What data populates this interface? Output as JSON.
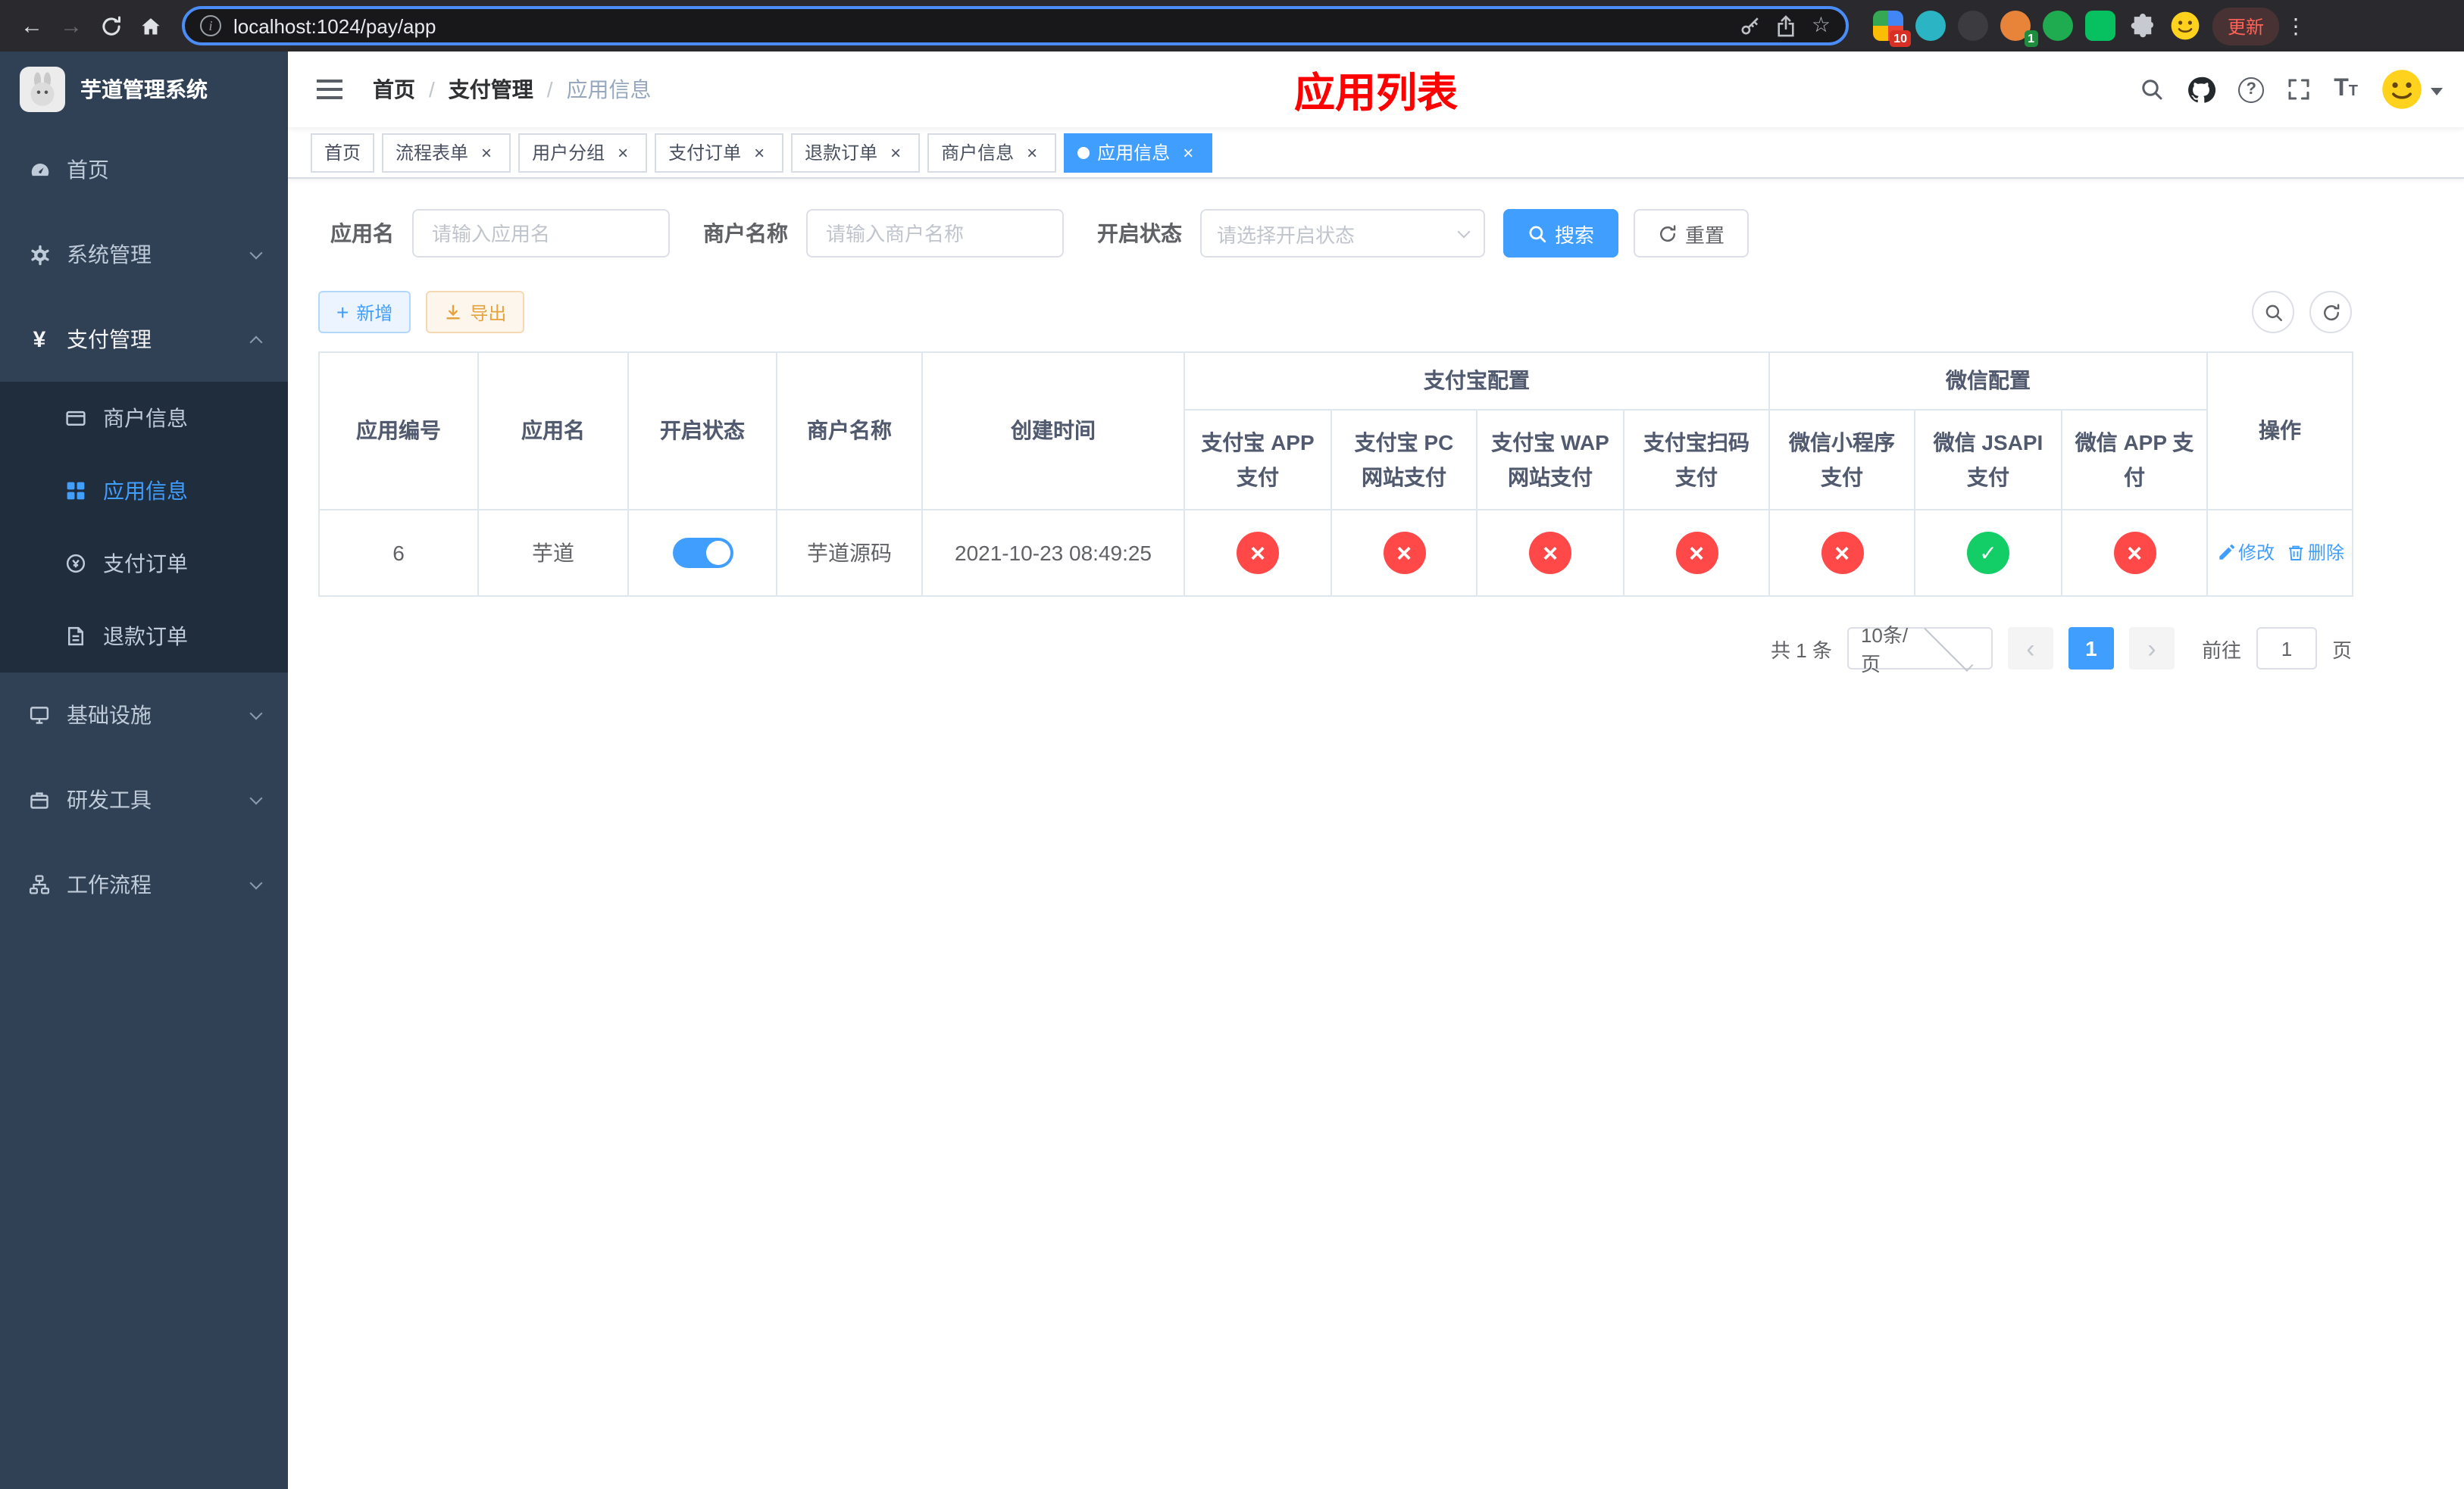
{
  "theme": {
    "accent": "#409eff",
    "danger_red": "#ff4949",
    "success_green": "#13ce66",
    "title_red": "#ff0000",
    "sidebar_bg": "#304156",
    "submenu_bg": "#1f2d3d"
  },
  "browser": {
    "url": "localhost:1024/pay/app",
    "update_label": "更新",
    "ext_badge1": "10",
    "ext_badge2": "1"
  },
  "sidebar": {
    "title": "芋道管理系统",
    "items": [
      {
        "label": "首页"
      },
      {
        "label": "系统管理"
      },
      {
        "label": "支付管理"
      },
      {
        "label": "基础设施"
      },
      {
        "label": "研发工具"
      },
      {
        "label": "工作流程"
      }
    ],
    "submenu": [
      {
        "label": "商户信息"
      },
      {
        "label": "应用信息"
      },
      {
        "label": "支付订单"
      },
      {
        "label": "退款订单"
      }
    ]
  },
  "navbar": {
    "breadcrumb": {
      "home": "首页",
      "section": "支付管理",
      "current": "应用信息",
      "separator": "/"
    },
    "page_title": "应用列表"
  },
  "tabs": [
    {
      "label": "首页"
    },
    {
      "label": "流程表单"
    },
    {
      "label": "用户分组"
    },
    {
      "label": "支付订单"
    },
    {
      "label": "退款订单"
    },
    {
      "label": "商户信息"
    },
    {
      "label": "应用信息"
    }
  ],
  "filters": {
    "app_name": {
      "label": "应用名",
      "placeholder": "请输入应用名"
    },
    "merchant_name": {
      "label": "商户名称",
      "placeholder": "请输入商户名称"
    },
    "status": {
      "label": "开启状态",
      "placeholder": "请选择开启状态"
    },
    "search_label": "搜索",
    "reset_label": "重置"
  },
  "toolbar": {
    "add_label": "新增",
    "export_label": "导出"
  },
  "table": {
    "headers": {
      "app_id": "应用编号",
      "app_name": "应用名",
      "status": "开启状态",
      "merchant": "商户名称",
      "created": "创建时间",
      "alipay_group": "支付宝配置",
      "wechat_group": "微信配置",
      "alipay_app": "支付宝 APP 支付",
      "alipay_pc": "支付宝 PC 网站支付",
      "alipay_wap": "支付宝 WAP 网站支付",
      "alipay_qr": "支付宝扫码支付",
      "wechat_lite": "微信小程序支付",
      "wechat_jsapi": "微信 JSAPI 支付",
      "wechat_app": "微信 APP 支付",
      "actions": "操作"
    },
    "row": {
      "app_id": "6",
      "app_name": "芋道",
      "status_on": true,
      "merchant": "芋道源码",
      "created": "2021-10-23 08:49:25",
      "alipay_app": false,
      "alipay_pc": false,
      "alipay_wap": false,
      "alipay_qr": false,
      "wechat_lite": false,
      "wechat_jsapi": true,
      "wechat_app": false,
      "edit_label": "修改",
      "delete_label": "删除"
    }
  },
  "pagination": {
    "total": "共 1 条",
    "page_size": "10条/页",
    "page": "1",
    "goto_label": "前往",
    "goto_value": "1",
    "unit_label": "页"
  }
}
